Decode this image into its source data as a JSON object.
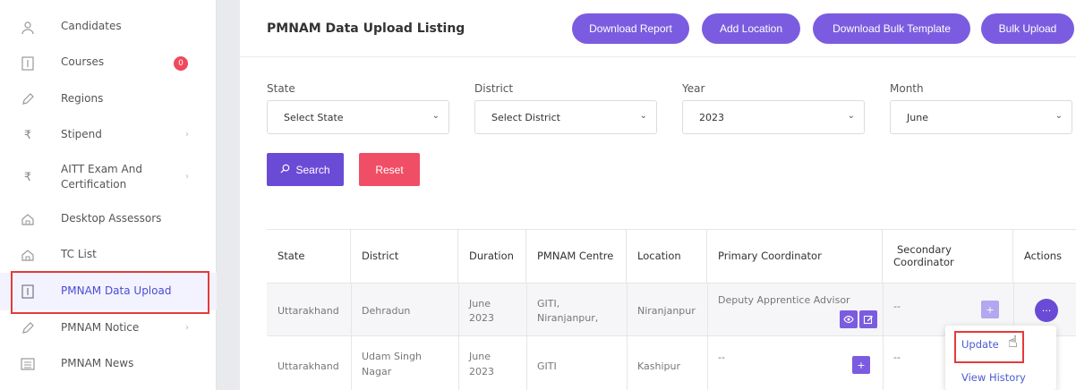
{
  "sidebar": {
    "items": [
      {
        "label": "Candidates",
        "icon": "user-icon"
      },
      {
        "label": "Courses",
        "icon": "book-icon",
        "badge": "0"
      },
      {
        "label": "Regions",
        "icon": "pen-icon"
      },
      {
        "label": "Stipend",
        "icon": "rupee-icon"
      },
      {
        "label": "AITT Exam And Certification",
        "label_line1": "AITT Exam And",
        "label_line2": "Certification",
        "icon": "rupee-icon"
      },
      {
        "label": "Desktop Assessors",
        "icon": "home-icon"
      },
      {
        "label": "TC List",
        "icon": "home-icon"
      },
      {
        "label": "PMNAM Data Upload",
        "icon": "document-icon"
      },
      {
        "label": "PMNAM Notice",
        "icon": "pen-icon"
      },
      {
        "label": "PMNAM News",
        "icon": "news-icon"
      }
    ]
  },
  "header": {
    "title": "PMNAM Data Upload Listing",
    "buttons": {
      "download_report": "Download Report",
      "add_location": "Add Location",
      "download_bulk_template": "Download Bulk Template",
      "bulk_upload": "Bulk Upload"
    }
  },
  "filters": {
    "state": {
      "label": "State",
      "value": "Select State"
    },
    "district": {
      "label": "District",
      "value": "Select District"
    },
    "year": {
      "label": "Year",
      "value": "2023"
    },
    "month": {
      "label": "Month",
      "value": "June"
    },
    "search_label": "Search",
    "reset_label": "Reset"
  },
  "table": {
    "headers": {
      "state": "State",
      "district": "District",
      "duration": "Duration",
      "centre": "PMNAM Centre",
      "location": "Location",
      "primary": "Primary Coordinator",
      "secondary_1": "Secondary",
      "secondary_2": "Coordinator",
      "actions": "Actions"
    },
    "rows": [
      {
        "state": "Uttarakhand",
        "district": "Dehradun",
        "duration_1": "June",
        "duration_2": "2023",
        "centre_1": "GITI,",
        "centre_2": "Niranjanpur,",
        "location": "Niranjanpur",
        "primary": "Deputy Apprentice Advisor",
        "secondary": "--"
      },
      {
        "state": "Uttarakhand",
        "district_1": "Udam Singh",
        "district_2": "Nagar",
        "duration_1": "June",
        "duration_2": "2023",
        "centre": "GITI",
        "location": "Kashipur",
        "primary": "--",
        "secondary": "--"
      }
    ]
  },
  "actions_menu": {
    "update": "Update",
    "view_history": "View History"
  },
  "colors": {
    "accent": "#7b5ce0",
    "reset": "#f04e66",
    "highlight": "#e53a3a"
  }
}
